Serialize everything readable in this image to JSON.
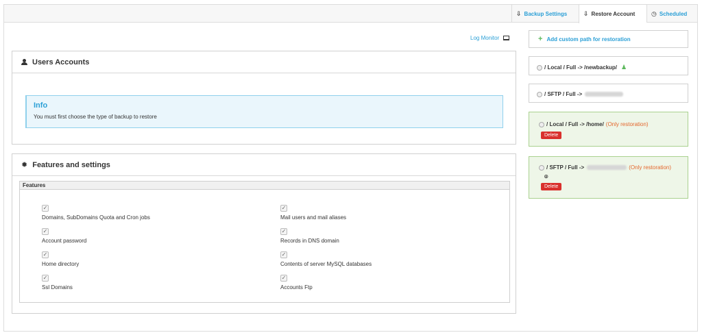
{
  "tabs": [
    {
      "label": "Backup Settings",
      "icon": "download-icon",
      "active": false
    },
    {
      "label": "Restore Account",
      "icon": "download-icon",
      "active": true
    },
    {
      "label": "Scheduled",
      "icon": "clock-icon",
      "active": false
    }
  ],
  "log_monitor": {
    "label": "Log Monitor",
    "icon": "monitor-icon"
  },
  "users_panel": {
    "title": "Users Accounts",
    "info": {
      "title": "Info",
      "text": "You must first choose the type of backup to restore"
    }
  },
  "features_panel": {
    "title": "Features and settings",
    "legend": "Features",
    "items": [
      {
        "label": "Domains, SubDomains Quota and Cron jobs",
        "checked": true
      },
      {
        "label": "Mail users and mail aliases",
        "checked": true
      },
      {
        "label": "Account password",
        "checked": true
      },
      {
        "label": "Records in DNS domain",
        "checked": true
      },
      {
        "label": "Home directory",
        "checked": true
      },
      {
        "label": "Contents of server MySQL databases",
        "checked": true
      },
      {
        "label": "Ssl Domains",
        "checked": true
      },
      {
        "label": "Accounts Ftp",
        "checked": true
      }
    ]
  },
  "sidebar": {
    "add_label": "Add custom path for restoration",
    "paths": [
      {
        "label": "/ Local / Full -> /newbackup/",
        "note": ""
      },
      {
        "label": "/ SFTP / Full ->",
        "note": ""
      },
      {
        "label": "/ Local / Full -> /home/",
        "note": "(Only restoration)",
        "delete": "Delete"
      },
      {
        "label": "/ SFTP / Full ->",
        "note": "(Only restoration)",
        "delete": "Delete"
      }
    ]
  },
  "colors": {
    "link": "#2a9fd6",
    "success": "#5cb85c",
    "danger": "#d9302c",
    "warning_text": "#e4662c"
  }
}
